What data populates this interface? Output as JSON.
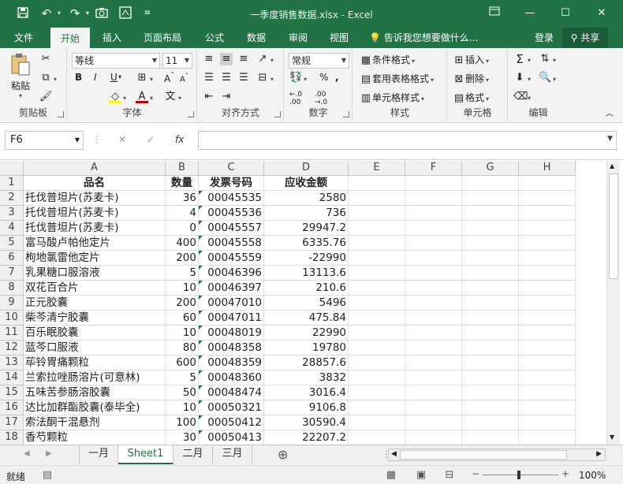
{
  "window": {
    "title": "一季度销售数据.xlsx - Excel"
  },
  "tabs": [
    "文件",
    "开始",
    "插入",
    "页面布局",
    "公式",
    "数据",
    "审阅",
    "视图"
  ],
  "tell_me": "告诉我您想要做什么...",
  "login": "登录",
  "share": "共享",
  "ribbon": {
    "paste": "粘贴",
    "font_name": "等线",
    "font_size": "11",
    "number_format": "常规",
    "bold": "B",
    "italic": "I",
    "underline": "U",
    "font_color_letter": "A",
    "cond_format": "条件格式",
    "table_format": "套用表格格式",
    "cell_style": "单元格样式",
    "insert": "插入",
    "delete": "删除",
    "format": "格式",
    "percent": "%",
    "groups": {
      "clipboard": "剪贴板",
      "font": "字体",
      "align": "对齐方式",
      "number": "数字",
      "styles": "样式",
      "cells": "单元格",
      "edit": "编辑"
    }
  },
  "formula_bar": {
    "name_box": "F6",
    "fx": "fx",
    "value": ""
  },
  "columns": [
    "A",
    "B",
    "C",
    "D",
    "E",
    "F",
    "G",
    "H"
  ],
  "rows": [
    {
      "n": "1",
      "a": "品名",
      "b": "数量",
      "c": "发票号码",
      "d": "应收金额",
      "header": true
    },
    {
      "n": "2",
      "a": "托伐普坦片(苏麦卡)",
      "b": "36",
      "c": "00045535",
      "d": "2580"
    },
    {
      "n": "3",
      "a": "托伐普坦片(苏麦卡)",
      "b": "4",
      "c": "00045536",
      "d": "736"
    },
    {
      "n": "4",
      "a": "托伐普坦片(苏麦卡)",
      "b": "0",
      "c": "00045557",
      "d": "29947.2"
    },
    {
      "n": "5",
      "a": "富马酸卢帕他定片",
      "b": "400",
      "c": "00045558",
      "d": "6335.76"
    },
    {
      "n": "6",
      "a": "枸地氯雷他定片",
      "b": "200",
      "c": "00045559",
      "d": "-22990"
    },
    {
      "n": "7",
      "a": "乳果糖口服溶液",
      "b": "5",
      "c": "00046396",
      "d": "13113.6"
    },
    {
      "n": "8",
      "a": "双花百合片",
      "b": "10",
      "c": "00046397",
      "d": "210.6"
    },
    {
      "n": "9",
      "a": "正元胶囊",
      "b": "200",
      "c": "00047010",
      "d": "5496"
    },
    {
      "n": "10",
      "a": "柴芩清宁胶囊",
      "b": "60",
      "c": "00047011",
      "d": "475.84"
    },
    {
      "n": "11",
      "a": "百乐眠胶囊",
      "b": "10",
      "c": "00048019",
      "d": "22990"
    },
    {
      "n": "12",
      "a": "蓝芩口服液",
      "b": "80",
      "c": "00048358",
      "d": "19780"
    },
    {
      "n": "13",
      "a": "荜铃胃痛颗粒",
      "b": "600",
      "c": "00048359",
      "d": "28857.6"
    },
    {
      "n": "14",
      "a": "兰索拉唑肠溶片(可意林)",
      "b": "5",
      "c": "00048360",
      "d": "3832"
    },
    {
      "n": "15",
      "a": "五味苦参肠溶胶囊",
      "b": "50",
      "c": "00048474",
      "d": "3016.4"
    },
    {
      "n": "16",
      "a": "达比加群酯胶囊(泰毕全)",
      "b": "10",
      "c": "00050321",
      "d": "9106.8"
    },
    {
      "n": "17",
      "a": "索法酮干混悬剂",
      "b": "100",
      "c": "00050412",
      "d": "30590.4"
    },
    {
      "n": "18",
      "a": "香芍颗粒",
      "b": "30",
      "c": "00050413",
      "d": "22207.2"
    }
  ],
  "sheets": [
    "一月",
    "Sheet1",
    "二月",
    "三月"
  ],
  "active_sheet": "Sheet1",
  "status": {
    "ready": "就绪",
    "zoom": "100%"
  },
  "colors": {
    "accent": "#217346"
  }
}
